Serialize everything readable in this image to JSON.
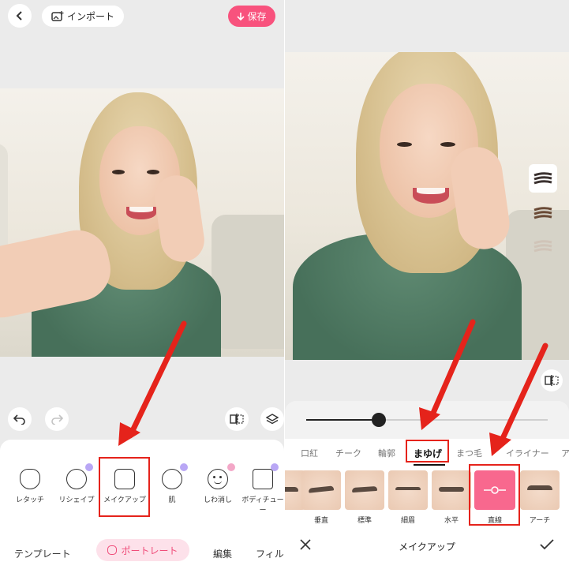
{
  "left": {
    "import_label": "インポート",
    "save_label": "保存",
    "tools": [
      {
        "label": "レタッチ",
        "icon": "retouch-icon"
      },
      {
        "label": "リシェイプ",
        "icon": "reshape-icon"
      },
      {
        "label": "メイクアップ",
        "icon": "makeup-icon"
      },
      {
        "label": "肌",
        "icon": "skin-icon"
      },
      {
        "label": "しわ消し",
        "icon": "wrinkle-icon"
      },
      {
        "label": "ボディチューー",
        "icon": "body-tune-icon"
      }
    ],
    "tabs": {
      "template": "テンプレート",
      "portrait": "ポートレート",
      "edit": "編集",
      "filter": "フィル"
    }
  },
  "right": {
    "categories": [
      "口紅",
      "チーク",
      "輪郭",
      "まゆげ",
      "まつ毛",
      "イライナー",
      "ア"
    ],
    "active_category": "まゆげ",
    "brow_styles": [
      "垂直",
      "標準",
      "細眉",
      "水平",
      "直線",
      "アーチ"
    ],
    "selected_style": "直線",
    "slider_value": 0.3,
    "sheet_title": "メイクアップ",
    "accent_color": "#f8527d",
    "highlight_color": "#e5231b"
  }
}
